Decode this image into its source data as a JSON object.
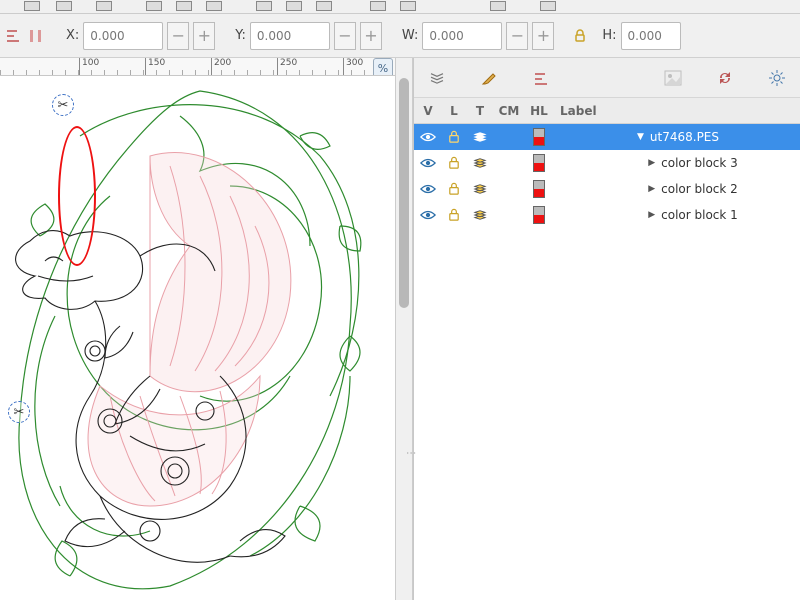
{
  "coords": {
    "x_label": "X:",
    "x_value": "0.000",
    "y_label": "Y:",
    "y_value": "0.000",
    "w_label": "W:",
    "w_value": "0.000",
    "h_label": "H:",
    "h_value": "0.000"
  },
  "ruler": {
    "ticks": [
      {
        "pos": 100,
        "label": "100"
      },
      {
        "pos": 150,
        "label": "150"
      },
      {
        "pos": 200,
        "label": "200"
      },
      {
        "pos": 250,
        "label": "250"
      },
      {
        "pos": 300,
        "label": "300"
      }
    ]
  },
  "layers_panel": {
    "columns": {
      "v": "V",
      "l": "L",
      "t": "T",
      "cm": "CM",
      "hl": "HL",
      "label": "Label"
    },
    "rows": [
      {
        "selected": true,
        "depth": 0,
        "expand": "down",
        "label": "ut7468.PES",
        "hl_top": "#bbb",
        "hl_bot": "#e11",
        "t_tint": "#fff"
      },
      {
        "selected": false,
        "depth": 1,
        "expand": "right",
        "label": "color block 3",
        "hl_top": "#bbb",
        "hl_bot": "#e11",
        "t_tint": "#ffd24a"
      },
      {
        "selected": false,
        "depth": 1,
        "expand": "right",
        "label": "color block 2",
        "hl_top": "#bbb",
        "hl_bot": "#e11",
        "t_tint": "#ffd24a"
      },
      {
        "selected": false,
        "depth": 1,
        "expand": "right",
        "label": "color block 1",
        "hl_top": "#bbb",
        "hl_bot": "#e11",
        "t_tint": "#ffd24a"
      }
    ]
  },
  "annotation": {
    "note": "red ellipse highlighting T (layer type) column"
  }
}
